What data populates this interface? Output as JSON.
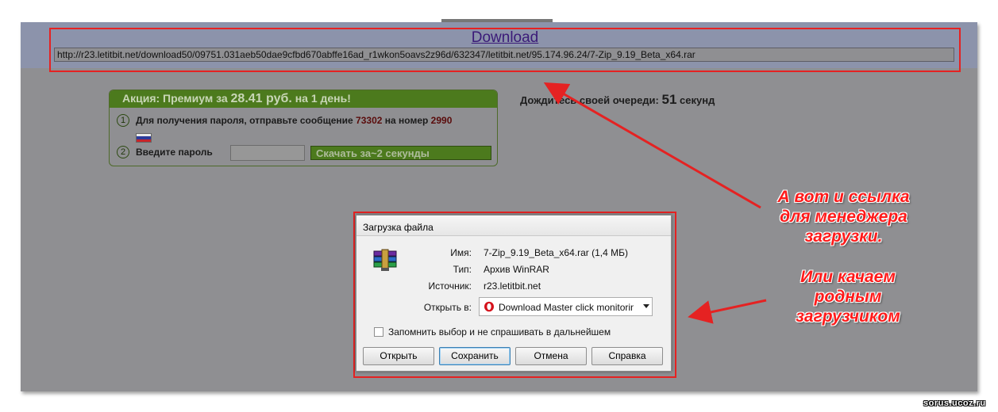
{
  "download_section": {
    "link_text": "Download",
    "url": "http://r23.letitbit.net/download50/09751.031aeb50dae9cfbd670abffe16ad_r1wkon5oavs2z96d/632347/letitbit.net/95.174.96.24/7-Zip_9.19_Beta_x64.rar"
  },
  "promo": {
    "title_prefix": "Акция: Премиум за",
    "price": "28.41 руб.",
    "title_suffix": "на 1 день!",
    "step1_num": "1",
    "step1_text": "Для получения пароля, отправьте сообщение",
    "sms_code": "73302",
    "step1_mid": "на номер",
    "sms_number": "2990",
    "step2_num": "2",
    "step2_label": "Введите пароль",
    "password_value": "",
    "download_button": "Скачать за~2 секунды"
  },
  "queue": {
    "text_prefix": "Дождитесь своей очереди:",
    "seconds": "51",
    "text_suffix": "секунд"
  },
  "dialog": {
    "title": "Загрузка файла",
    "name_label": "Имя:",
    "name_value": "7-Zip_9.19_Beta_x64.rar (1,4 МБ)",
    "type_label": "Тип:",
    "type_value": "Архив WinRAR",
    "source_label": "Источник:",
    "source_value": "r23.letitbit.net",
    "open_in_label": "Открыть в:",
    "open_in_value": "Download Master click monitoring",
    "remember_label": "Запомнить выбор и не спрашивать в дальнейшем",
    "remember_checked": false,
    "buttons": {
      "open": "Открыть",
      "save": "Сохранить",
      "cancel": "Отмена",
      "help": "Справка"
    }
  },
  "annotations": {
    "link_note_1": "А вот и ссылка",
    "link_note_2": "для менеджера",
    "link_note_3": "загрузки.",
    "native_note_1": "Или качаем",
    "native_note_2": "родным",
    "native_note_3": "загрузчиком"
  },
  "watermark": "sorus.ucoz.ru",
  "colors": {
    "annotation_red": "#e52222",
    "promo_green": "#4c7a1d",
    "overlay_gray": "#8f8f92"
  }
}
